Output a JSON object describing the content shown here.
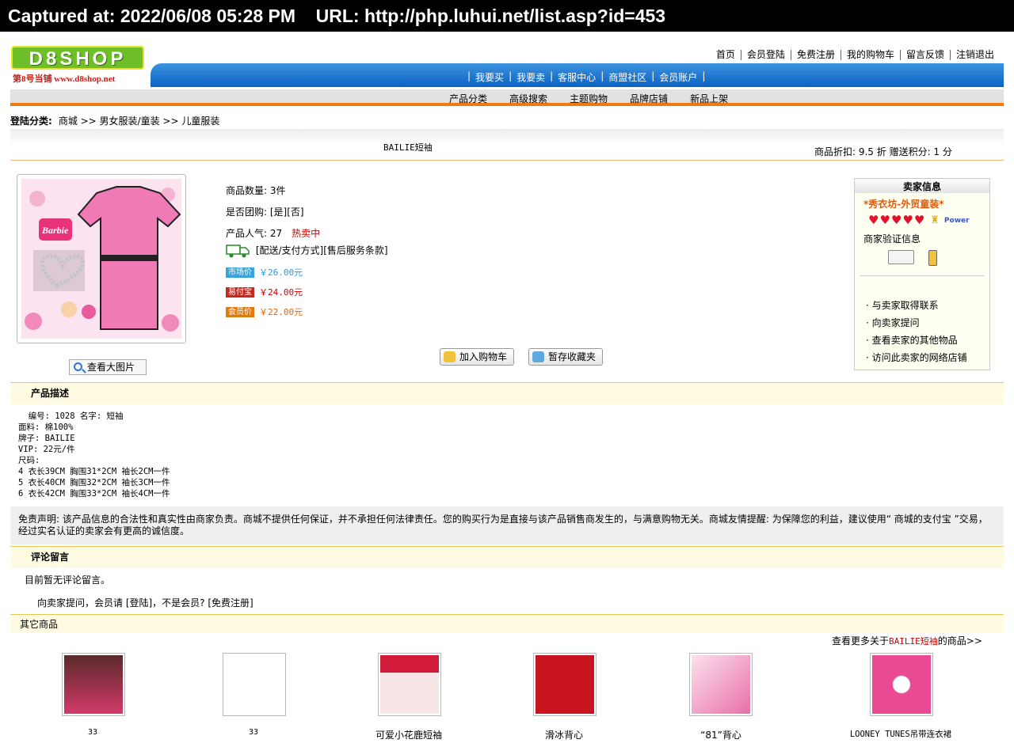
{
  "capture": {
    "text": "Captured at: 2022/06/08 05:28 PM    URL: http://php.luhui.net/list.asp?id=453"
  },
  "logo": {
    "mark": "D8SHOP",
    "sub": "第8号当铺 www.d8shop.net"
  },
  "top_links": [
    "首页",
    "会员登陆",
    "免费注册",
    "我的购物车",
    "留言反馈",
    "注销退出"
  ],
  "nav_blue": [
    "我要买",
    "我要卖",
    "客服中心",
    "商盟社区",
    "会员账户"
  ],
  "nav_grey": [
    "产品分类",
    "高级搜索",
    "主题购物",
    "品牌店铺",
    "新品上架"
  ],
  "breadcrumb": {
    "label": "登陆分类:",
    "path": "商城 >> 男女服装/童装 >> 儿童服装"
  },
  "product": {
    "title": "BAILIE短袖",
    "discount": "商品折扣: 9.5 折  赠送积分: 1 分",
    "quantity": "商品数量: 3件",
    "group_buy": "是否团购: [是][否]",
    "popularity": "产品人气: 27",
    "hot": "热卖中",
    "shipping": "[配送/支付方式][售后服务条款]",
    "market_tag": "市场价",
    "market_price": "￥26.00元",
    "alipay_tag": "易付宝",
    "alipay_price": "￥24.00元",
    "member_tag": "会员价",
    "member_price": "￥22.00元",
    "view_large": "查看大图片",
    "add_cart": "加入购物车",
    "save_fav": "暂存收藏夹",
    "image_brand": "Barbie"
  },
  "seller": {
    "heading": "卖家信息",
    "name": "*秀衣坊-外贸童装*",
    "rating_hearts": 5,
    "power": "Power",
    "verify": "商家验证信息",
    "links": [
      "与卖家取得联系",
      "向卖家提问",
      "查看卖家的其他物品",
      "访问此卖家的网络店铺"
    ]
  },
  "description": {
    "heading": "产品描述",
    "text": "  编号: 1028 名字: 短袖\n面料: 棉100%\n牌子: BAILIE\nVIP: 22元/件\n尺码:\n4 衣长39CM 胸围31*2CM 袖长2CM一件\n5 衣长40CM 胸围32*2CM 袖长3CM一件\n6 衣长42CM 胸围33*2CM 袖长4CM一件"
  },
  "disclaimer": "免责声明: 该产品信息的合法性和真实性由商家负责。商城不提供任何保证，并不承担任何法律责任。您的购买行为是直接与该产品销售商发生的，与满意购物无关。商城友情提醒: 为保障您的利益，建议使用“  商城的支付宝 ”交易，经过实名认证的卖家会有更高的诚信度。",
  "comments": {
    "heading": "评论留言",
    "empty": "目前暂无评论留言。",
    "ask": "向卖家提问，会员请 [登陆]，不是会员? [免费注册]"
  },
  "other": {
    "heading": "其它商品",
    "more_prefix": "查看更多关于",
    "more_brand": "BAILIE短袖",
    "more_suffix": "的商品>>",
    "items": [
      {
        "label": "33",
        "color": "#5a2a2a"
      },
      {
        "label": "33",
        "color": "#ffffff"
      },
      {
        "label": "可爱小花鹿短袖",
        "color": "#f4d6d8"
      },
      {
        "label": "滑冰背心",
        "color": "#c8141e"
      },
      {
        "label": "“81”背心",
        "color": "#f7c3dd"
      },
      {
        "label": "LOONEY TUNES吊带连衣裙",
        "color": "#e94a93"
      }
    ]
  },
  "colors": {
    "blue": "#0a62c4",
    "orange": "#f07a12",
    "accent_red": "#c00000"
  }
}
